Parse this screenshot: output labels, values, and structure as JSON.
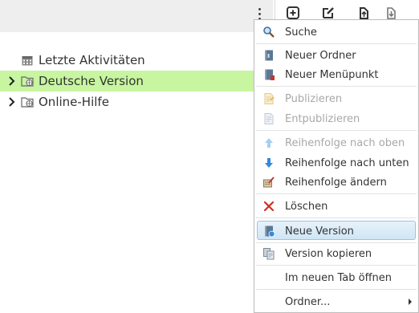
{
  "tree": {
    "items": [
      {
        "label": "Letzte Aktivitäten",
        "icon": "calendar-icon"
      },
      {
        "label": "Deutsche Version",
        "icon": "folder-globe-icon",
        "selected": true
      },
      {
        "label": "Online-Hilfe",
        "icon": "folder-globe-icon"
      }
    ]
  },
  "toolbar": {
    "icons": [
      "add-icon",
      "edit-icon",
      "upload-icon",
      "download-icon"
    ]
  },
  "menu": {
    "items": [
      {
        "label": "Suche",
        "icon": "search-icon",
        "enabled": true
      },
      {
        "label": "Neuer Ordner",
        "icon": "new-folder-icon",
        "enabled": true
      },
      {
        "label": "Neuer Menüpunkt",
        "icon": "new-menu-item-icon",
        "enabled": true
      },
      {
        "label": "Publizieren",
        "icon": "publish-icon",
        "enabled": false
      },
      {
        "label": "Entpublizieren",
        "icon": "unpublish-icon",
        "enabled": false
      },
      {
        "label": "Reihenfolge nach oben",
        "icon": "arrow-up-icon",
        "enabled": false
      },
      {
        "label": "Reihenfolge nach unten",
        "icon": "arrow-down-icon",
        "enabled": true
      },
      {
        "label": "Reihenfolge ändern",
        "icon": "reorder-icon",
        "enabled": true
      },
      {
        "label": "Löschen",
        "icon": "delete-icon",
        "enabled": true
      },
      {
        "label": "Neue Version",
        "icon": "new-version-icon",
        "enabled": true,
        "highlighted": true
      },
      {
        "label": "Version kopieren",
        "icon": "copy-version-icon",
        "enabled": true
      },
      {
        "label": "Im neuen Tab öffnen",
        "enabled": true
      },
      {
        "label": "Ordner...",
        "enabled": true,
        "submenu": true
      }
    ]
  },
  "colors": {
    "selection": "#c8f5a0",
    "menu_highlight": "#cfe6f5",
    "disabled_text": "#a8a8a8"
  }
}
